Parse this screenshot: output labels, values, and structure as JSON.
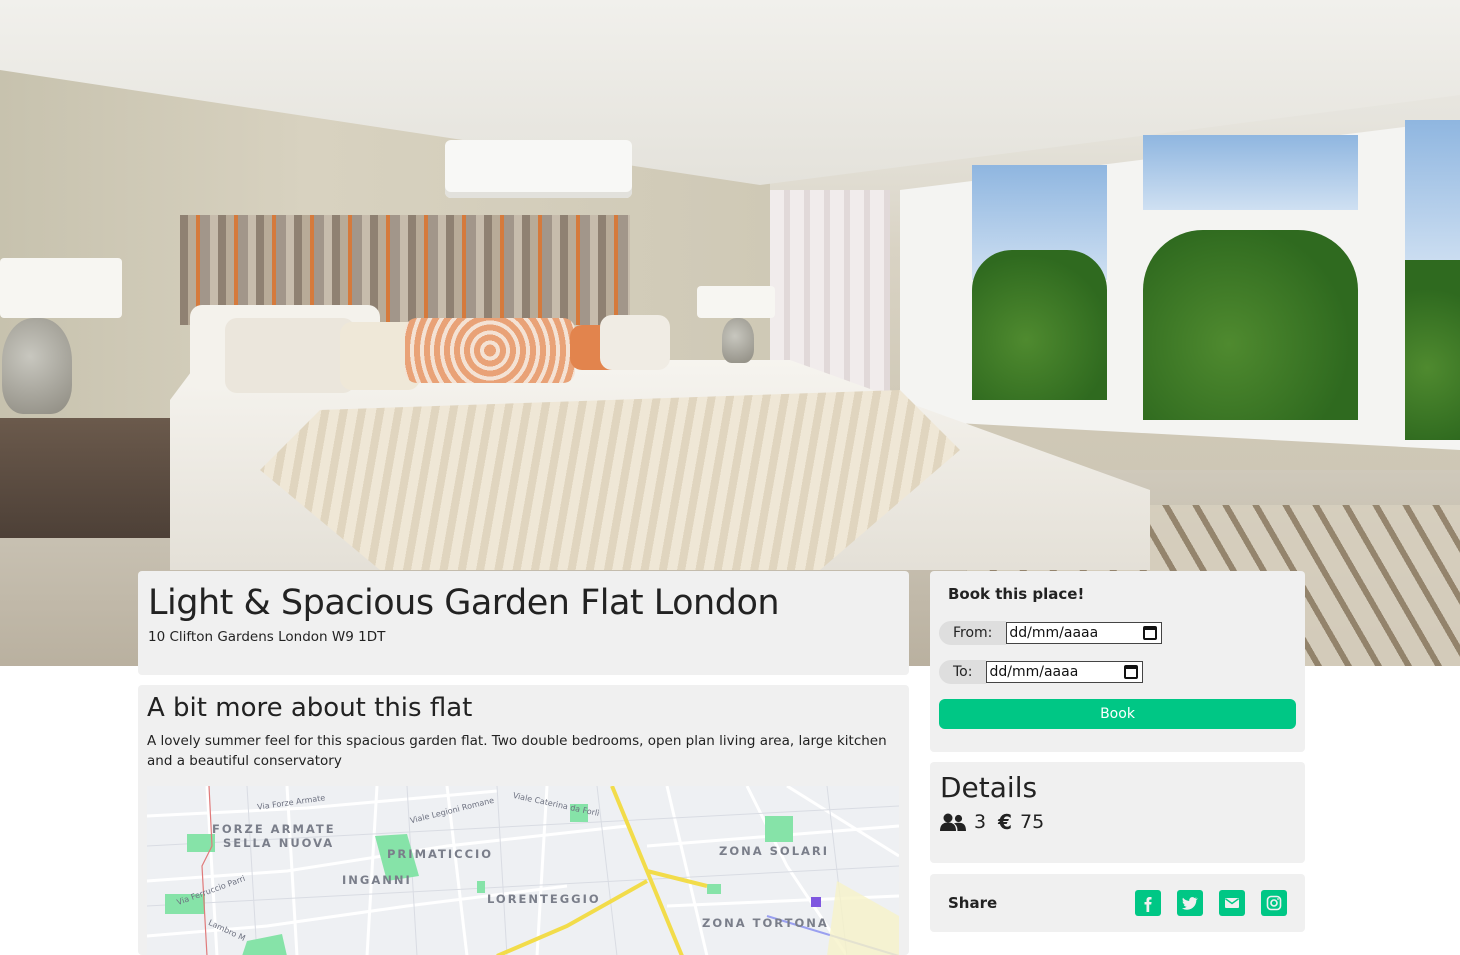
{
  "listing": {
    "title": "Light & Spacious Garden Flat London",
    "address": "10 Clifton Gardens London W9 1DT",
    "about_heading": "A bit more about this flat",
    "description": "A lovely summer feel for this spacious garden flat. Two double bedrooms, open plan living area, large kitchen and a beautiful conservatory"
  },
  "map": {
    "areas": [
      "FORZE ARMATE",
      "SELLA NUOVA",
      "PRIMATICCIO",
      "INGANNI",
      "LORENTEGGIO",
      "ZONA SOLARI",
      "ZONA TORTONA"
    ],
    "streets": [
      "Via Forze Armate",
      "Viale Legioni Romane",
      "Viale Caterina da Forlì",
      "Via Ferruccio Parri",
      "Lambro M"
    ]
  },
  "booking": {
    "heading": "Book this place!",
    "from_label": "From:",
    "from_placeholder": "dd/mm/aaaa",
    "to_label": "To:",
    "to_placeholder": "dd/mm/aaaa",
    "button_label": "Book"
  },
  "details": {
    "heading": "Details",
    "guests": "3",
    "currency_symbol": "€",
    "price": "75",
    "guests_icon": "users-icon"
  },
  "share": {
    "label": "Share",
    "icons": [
      "facebook-icon",
      "twitter-icon",
      "email-icon",
      "instagram-icon"
    ]
  },
  "colors": {
    "accent": "#00c785",
    "card_bg": "#f0f0f0"
  }
}
